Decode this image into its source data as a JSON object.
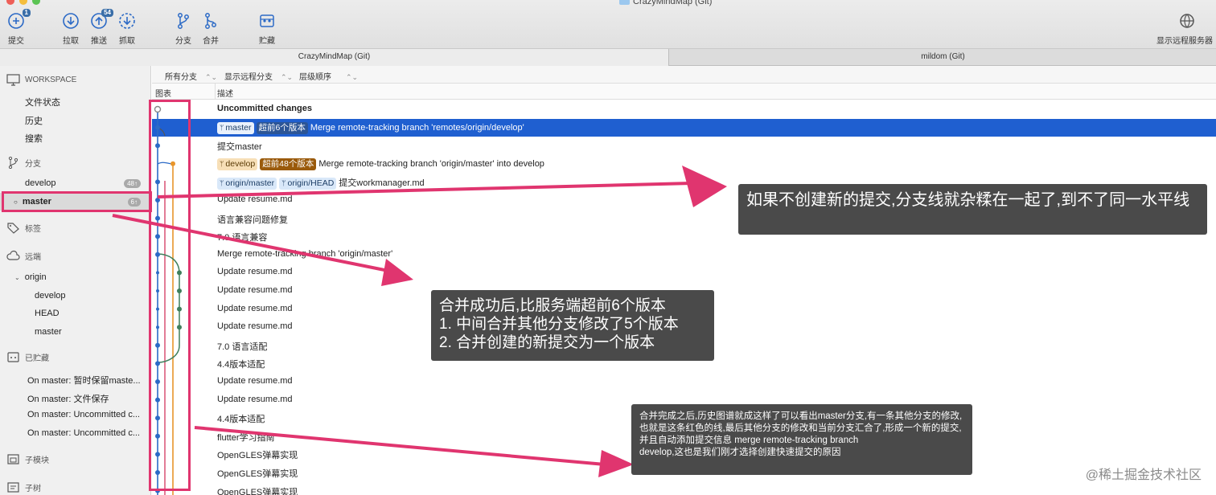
{
  "window": {
    "title": "CrazyMindMap (Git)"
  },
  "toolbar": {
    "commit": {
      "label": "提交",
      "badge": "1",
      "icon": "commit-icon"
    },
    "pull": {
      "label": "拉取",
      "icon": "pull-icon"
    },
    "push": {
      "label": "推送",
      "badge": "54",
      "icon": "push-icon"
    },
    "fetch": {
      "label": "抓取",
      "icon": "fetch-icon"
    },
    "branch": {
      "label": "分支",
      "icon": "branch-icon"
    },
    "merge": {
      "label": "合并",
      "icon": "merge-icon"
    },
    "stash": {
      "label": "贮藏",
      "icon": "stash-icon"
    },
    "remote": {
      "label": "显示远程服务器",
      "icon": "globe-icon"
    }
  },
  "repo_tabs": [
    "CrazyMindMap (Git)",
    "mildom (Git)"
  ],
  "sidebar": {
    "workspace": {
      "label": "WORKSPACE",
      "items": [
        "文件状态",
        "历史",
        "搜索"
      ]
    },
    "branches": {
      "label": "分支",
      "items": [
        {
          "name": "develop",
          "count": "48↑"
        },
        {
          "name": "master",
          "count": "6↑"
        }
      ]
    },
    "tags": {
      "label": "标签"
    },
    "remotes": {
      "label": "远端",
      "origin": "origin",
      "items": [
        "develop",
        "HEAD",
        "master"
      ]
    },
    "stashes": {
      "label": "已贮藏",
      "items": [
        "On master: 暂时保留maste...",
        "On master: 文件保存",
        "On master: Uncommitted c...",
        "On master: Uncommitted c..."
      ]
    },
    "submodules": {
      "label": "子模块"
    },
    "subtrees": {
      "label": "子树"
    }
  },
  "filters": {
    "branches": "所有分支",
    "remote": "显示远程分支",
    "order": "层级顺序"
  },
  "columns": {
    "graph": "图表",
    "description": "描述"
  },
  "commits": [
    {
      "text": "Uncommitted changes",
      "bold": true
    },
    {
      "branch": "master",
      "ahead": "超前6个版本",
      "text": "Merge remote-tracking branch 'remotes/origin/develop'",
      "selected": true
    },
    {
      "text": "提交master"
    },
    {
      "branch": "develop",
      "ahead": "超前48个版本",
      "text": "Merge remote-tracking branch 'origin/master' into develop"
    },
    {
      "remotes": [
        "origin/master",
        "origin/HEAD"
      ],
      "text": "提交workmanager.md"
    },
    {
      "text": "Update resume.md"
    },
    {
      "text": "语言兼容问题修复"
    },
    {
      "text": "7.0 语言兼容"
    },
    {
      "text": "Merge remote-tracking branch 'origin/master'"
    },
    {
      "text": "Update resume.md"
    },
    {
      "text": "Update resume.md"
    },
    {
      "text": "Update resume.md"
    },
    {
      "text": "Update resume.md"
    },
    {
      "text": "7.0 语言适配"
    },
    {
      "text": "4.4版本适配"
    },
    {
      "text": "Update resume.md"
    },
    {
      "text": "Update resume.md"
    },
    {
      "text": "4.4版本适配"
    },
    {
      "text": "flutter学习指南"
    },
    {
      "text": "OpenGLES弹幕实现"
    },
    {
      "text": "OpenGLES弹幕实现"
    },
    {
      "text": "OpenGLES弹幕实现"
    }
  ],
  "annotations": {
    "note1": "如果不创建新的提交,分支线就杂糅在一起了,到不了同一水平线",
    "note2": [
      "合并成功后,比服务端超前6个版本",
      "1. 中间合并其他分支修改了5个版本",
      "2. 合并创建的新提交为一个版本"
    ],
    "note3": [
      "合并完成之后,历史图谱就成这样了可以看出master分支,有一条其他分支的修改,也就是这条红色的线,最后其他分支的修改和当前分支汇合了,形成一个新的提交,并且自动添加提交信息 merge remote-tracking branch",
      "develop,这也是我们刚才选择创建快速提交的原因"
    ],
    "watermark": "@稀土掘金技术社区"
  },
  "colors": {
    "selection": "#1f5fd0",
    "annotation_red": "#e0356f",
    "note_bg": "#4a4a4a",
    "line_blue": "#2c6ac6",
    "line_orange": "#e8952b",
    "line_green": "#3f7f5c"
  }
}
